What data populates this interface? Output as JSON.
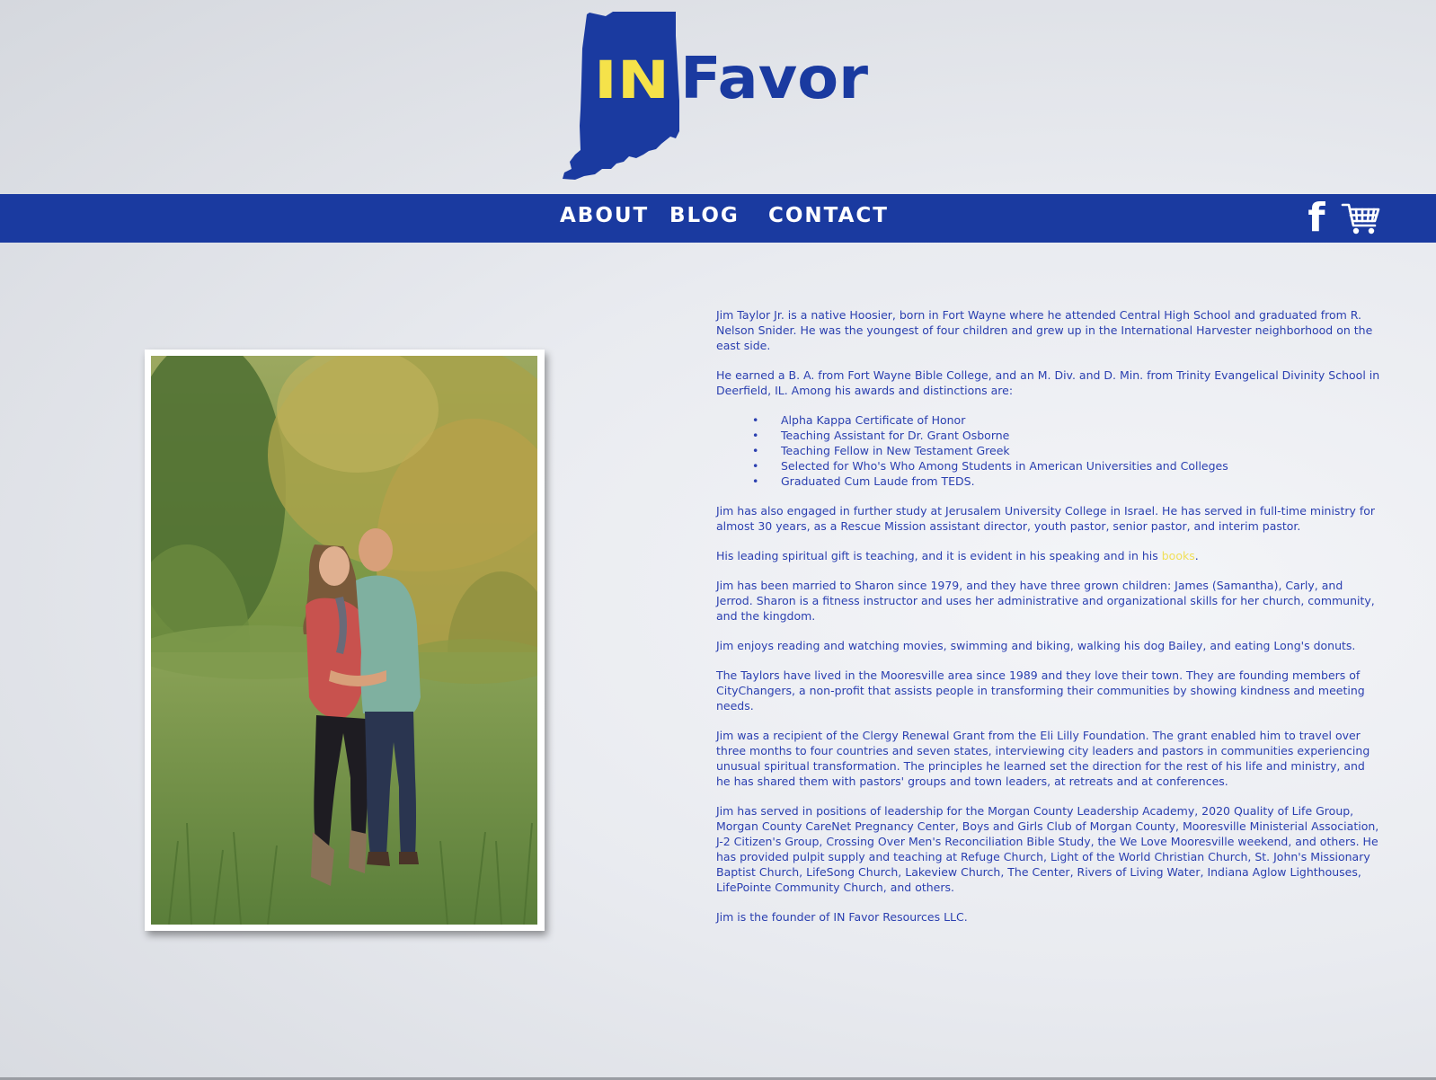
{
  "brand": {
    "in": "IN",
    "favor": "Favor",
    "blue": "#1a3aa0",
    "yellow": "#f5e24a"
  },
  "nav": {
    "items": [
      {
        "label": "ABOUT"
      },
      {
        "label": "BLOG"
      },
      {
        "label": "CONTACT"
      }
    ],
    "facebook_icon": "f",
    "cart_icon": "shopping-cart-icon"
  },
  "bio": {
    "p1": "Jim Taylor Jr. is a native Hoosier, born in Fort Wayne where he attended Central High School and graduated from R. Nelson Snider. He was the youngest of four children and grew up in the International Harvester neighborhood on the east side.",
    "p2": "He earned a B. A. from Fort Wayne Bible College, and an M. Div. and D. Min. from Trinity Evangelical Divinity School in Deerfield, IL. Among his awards and distinctions are:",
    "awards": [
      "Alpha Kappa Certificate of Honor",
      "Teaching Assistant for Dr. Grant Osborne",
      "Teaching Fellow in New Testament Greek",
      "Selected for Who's Who Among Students in American Universities and Colleges",
      "Graduated Cum Laude from TEDS."
    ],
    "p3": "Jim has also engaged in further study at Jerusalem University College in Israel. He has served in full-time ministry for almost 30 years, as a Rescue Mission assistant director, youth pastor, senior pastor, and interim pastor.",
    "p4_before": "His leading spiritual gift is teaching, and it is evident in his speaking and in his ",
    "p4_link": "books",
    "p4_after": ".",
    "p5": "Jim has been married to Sharon since 1979, and they have three grown children: James (Samantha), Carly, and Jerrod. Sharon is a fitness instructor and uses her administrative and organizational skills for her church, community, and the kingdom.",
    "p6": "Jim enjoys reading and watching movies, swimming and biking, walking his dog Bailey, and eating Long's donuts.",
    "p7": "The Taylors have lived in the Mooresville area since 1989 and they love their town. They are founding members of CityChangers, a non-profit that assists people in transforming their communities by showing kindness and meeting needs.",
    "p8": "Jim was a recipient of the Clergy Renewal Grant from the Eli Lilly Foundation. The grant enabled him to travel over three months to four countries and seven states, interviewing city leaders and pastors in communities experiencing unusual spiritual transformation. The principles he learned set the direction for the rest of his life and ministry, and he has shared them with pastors' groups and town leaders, at retreats and at conferences.",
    "p9": "Jim has served in positions of leadership for the Morgan County Leadership Academy, 2020 Quality of Life Group, Morgan County CareNet Pregnancy Center, Boys and Girls Club of Morgan County, Mooresville Ministerial Association, J-2 Citizen's Group, Crossing Over Men's Reconciliation Bible Study, the We Love Mooresville weekend, and others. He has provided pulpit supply and teaching at Refuge Church, Light of the World Christian Church, St. John's Missionary Baptist Church, LifeSong Church, Lakeview Church, The Center, Rivers of Living Water, Indiana Aglow Lighthouses, LifePointe Community Church, and others.",
    "p10": "Jim is the founder of IN Favor Resources LLC."
  }
}
